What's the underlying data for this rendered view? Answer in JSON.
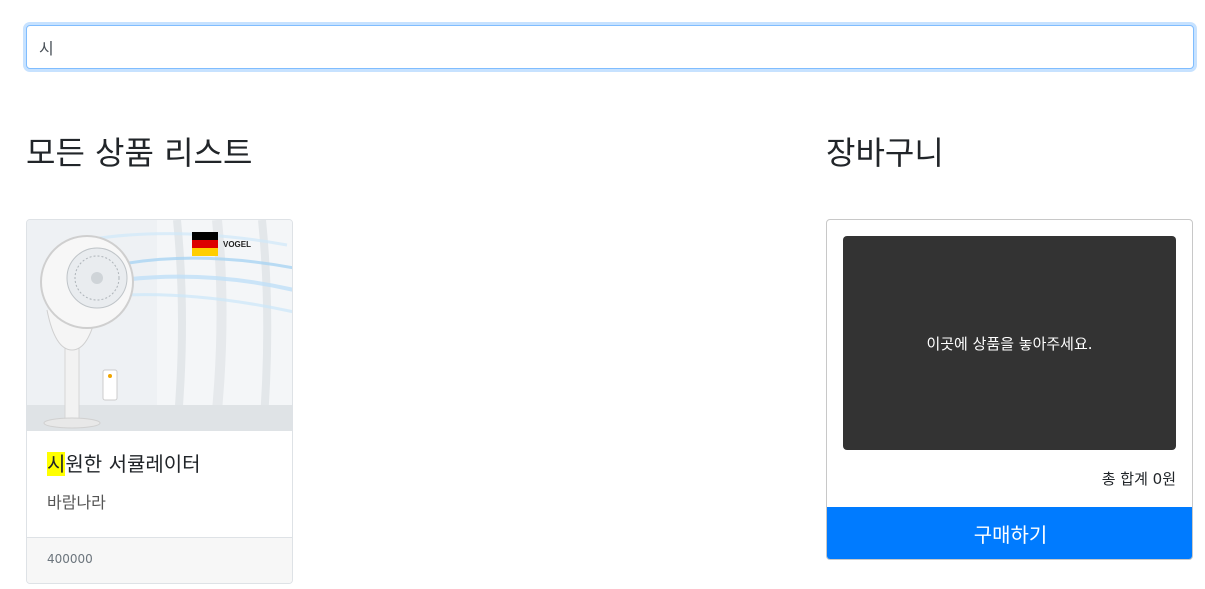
{
  "search": {
    "value": "시"
  },
  "products_section": {
    "title": "모든 상품 리스트",
    "items": [
      {
        "title_highlight": "시",
        "title_rest": "원한 서큘레이터",
        "maker": "바람나라",
        "price": "400000",
        "image": "circulator-fan-product-photo",
        "brand_logo_text": "VOGEL"
      }
    ]
  },
  "cart": {
    "title": "장바구니",
    "dropzone_text": "이곳에 상품을 놓아주세요.",
    "total_text": "총 합계 0원",
    "buy_label": "구매하기"
  },
  "colors": {
    "accent": "#007bff",
    "highlight": "#ffff00",
    "dropzone_bg": "#333333"
  }
}
